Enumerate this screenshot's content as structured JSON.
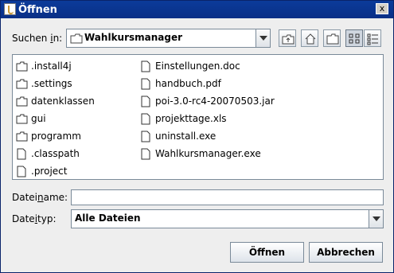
{
  "window": {
    "title": "Öffnen",
    "close_label": "x"
  },
  "lookin": {
    "label_pre": "Suchen ",
    "label_mn": "i",
    "label_post": "n:",
    "value": "Wahlkursmanager"
  },
  "files": [
    {
      "name": ".install4j",
      "kind": "folder"
    },
    {
      "name": ".settings",
      "kind": "folder"
    },
    {
      "name": "datenklassen",
      "kind": "folder"
    },
    {
      "name": "gui",
      "kind": "folder"
    },
    {
      "name": "programm",
      "kind": "folder"
    },
    {
      "name": ".classpath",
      "kind": "file"
    },
    {
      "name": ".project",
      "kind": "file"
    },
    {
      "name": "Einstellungen.doc",
      "kind": "file"
    },
    {
      "name": "handbuch.pdf",
      "kind": "file"
    },
    {
      "name": "poi-3.0-rc4-20070503.jar",
      "kind": "file"
    },
    {
      "name": "projekttage.xls",
      "kind": "file"
    },
    {
      "name": "uninstall.exe",
      "kind": "file"
    },
    {
      "name": "Wahlkursmanager.exe",
      "kind": "file"
    }
  ],
  "filename": {
    "label_pre": "Datei",
    "label_mn": "n",
    "label_post": "ame:",
    "value": ""
  },
  "filetype": {
    "label_pre": "Date",
    "label_mn": "i",
    "label_post": "typ:",
    "value": "Alle Dateien"
  },
  "buttons": {
    "open": "Öffnen",
    "cancel": "Abbrechen"
  }
}
